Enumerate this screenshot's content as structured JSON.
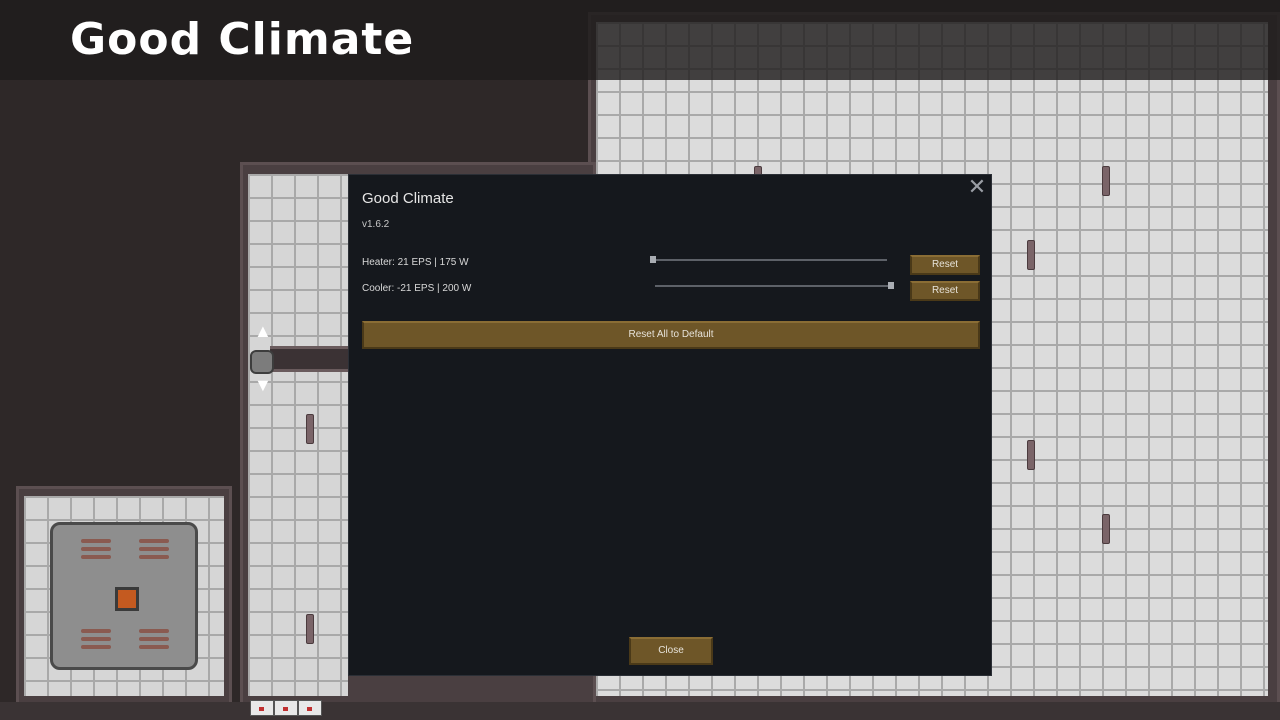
{
  "banner": {
    "title": "Good Climate"
  },
  "dialog": {
    "title": "Good Climate",
    "version": "v1.6.2",
    "close_icon": "close-icon",
    "settings": [
      {
        "label": "Heater: 21 EPS | 175 W",
        "slider_fraction": 0.0,
        "reset_label": "Reset"
      },
      {
        "label": "Cooler: -21 EPS | 200 W",
        "slider_fraction": 1.0,
        "reset_label": "Reset"
      }
    ],
    "reset_all_label": "Reset All to Default",
    "close_label": "Close"
  },
  "colors": {
    "dialog_bg": "#15181d",
    "button_bg": "#6e5628",
    "floor": "#d6d6d6",
    "wall": "#4a3f41"
  }
}
